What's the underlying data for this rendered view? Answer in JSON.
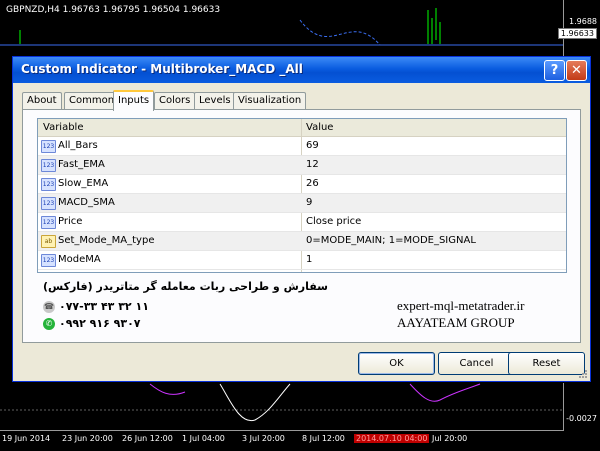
{
  "chart": {
    "title": "GBPNZD,H4  1.96763 1.96795 1.96504 1.96633",
    "price_labels": [
      "1.9688",
      "1.96633",
      "-0.0027"
    ],
    "time_labels": [
      "19 Jun 2014",
      "23 Jun 20:00",
      "26 Jun 12:00",
      "1 Jul 04:00",
      "3 Jul 20:00",
      "8 Jul 12:00",
      "2014.07.10 04:00",
      "Jul 20:00"
    ]
  },
  "dialog": {
    "title": "Custom Indicator - Multibroker_MACD _All",
    "help_label": "?",
    "close_label": "✕",
    "tabs": [
      "About",
      "Common",
      "Inputs",
      "Colors",
      "Levels",
      "Visualization"
    ],
    "active_tab": "Inputs",
    "table": {
      "headers": [
        "Variable",
        "Value"
      ],
      "rows": [
        {
          "type": "123",
          "variable": "All_Bars",
          "value": "69"
        },
        {
          "type": "123",
          "variable": "Fast_EMA",
          "value": "12"
        },
        {
          "type": "123",
          "variable": "Slow_EMA",
          "value": "26"
        },
        {
          "type": "123",
          "variable": "MACD_SMA",
          "value": "9"
        },
        {
          "type": "123",
          "variable": "Price",
          "value": "Close price"
        },
        {
          "type": "ab",
          "variable": "Set_Mode_MA_type",
          "value": "0=MODE_MAIN; 1=MODE_SIGNAL"
        },
        {
          "type": "123",
          "variable": "ModeMA",
          "value": "1"
        }
      ]
    },
    "promo": {
      "persian_text": "سفارش و طراحی ربات معامله گر متاتریدر (فارکس)",
      "phone1": "۰۷۷-۳۳ ۴۳ ۳۲ ۱۱",
      "phone2": "۰۹۹۲ ۹۱۶ ۹۳۰۷",
      "website": "expert-mql-metatrader.ir",
      "team": "AAYATEAM GROUP"
    },
    "buttons": {
      "ok": "OK",
      "cancel": "Cancel",
      "reset": "Reset"
    }
  },
  "colors": {
    "titlebar": "#0a5ce0",
    "dialog_bg": "#ece9d8",
    "indicator_line": "#cc33ff",
    "price_line": "#3a6df0"
  }
}
